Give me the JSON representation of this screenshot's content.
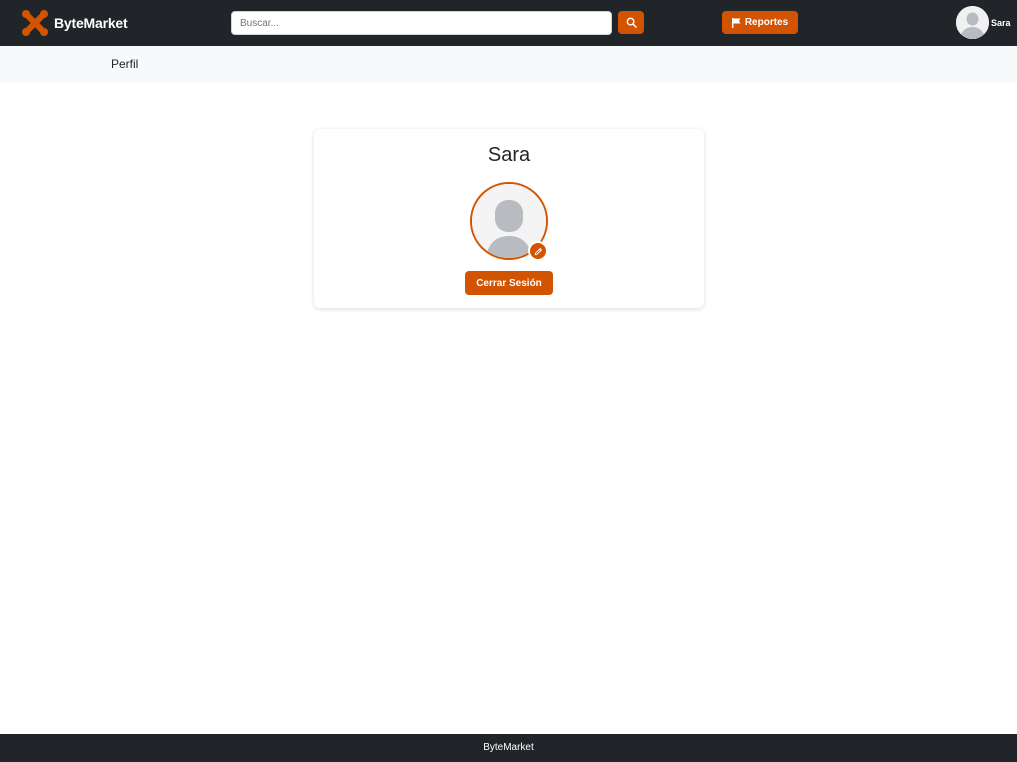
{
  "header": {
    "brand_name": "ByteMarket",
    "logo_icon": "x-logo-icon",
    "search": {
      "placeholder": "Buscar...",
      "value": "",
      "button_icon": "search-icon"
    },
    "reportes": {
      "label": "Reportes",
      "icon": "flag-icon"
    },
    "user": {
      "name": "Sara",
      "avatar_icon": "user-avatar-icon"
    }
  },
  "subheader": {
    "title": "Perfil"
  },
  "profile": {
    "name": "Sara",
    "avatar_icon": "user-avatar-icon",
    "edit_icon": "pencil-icon",
    "logout_label": "Cerrar Sesión"
  },
  "footer": {
    "text": "ByteMarket"
  },
  "colors": {
    "accent": "#d35400",
    "navbar": "#212529",
    "subheader": "#f8f9fa"
  }
}
